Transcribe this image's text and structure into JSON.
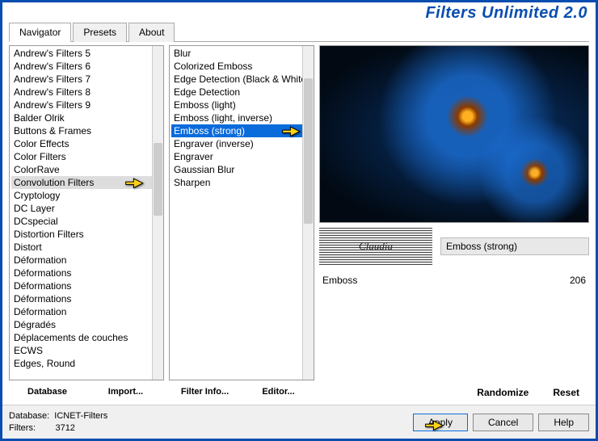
{
  "title": "Filters Unlimited 2.0",
  "tabs": [
    "Navigator",
    "Presets",
    "About"
  ],
  "active_tab": 0,
  "categories": {
    "items": [
      "Andrew's Filters 5",
      "Andrew's Filters 6",
      "Andrew's Filters 7",
      "Andrew's Filters 8",
      "Andrew's Filters 9",
      "Balder Olrik",
      "Buttons & Frames",
      "Color Effects",
      "Color Filters",
      "ColorRave",
      "Convolution Filters",
      "Cryptology",
      "DC Layer",
      "DCspecial",
      "Distortion Filters",
      "Distort",
      "Déformation",
      "Déformations",
      "Déformations",
      "Déformations",
      "Déformation",
      "Dégradés",
      "Déplacements de couches",
      "ECWS",
      "Edges, Round"
    ],
    "highlighted_index": 10,
    "buttons": [
      "Database",
      "Import..."
    ]
  },
  "filters": {
    "items": [
      "Blur",
      "Colorized Emboss",
      "Edge Detection (Black & White)",
      "Edge Detection",
      "Emboss (light)",
      "Emboss (light, inverse)",
      "Emboss (strong)",
      "Engraver (inverse)",
      "Engraver",
      "Gaussian Blur",
      "Sharpen"
    ],
    "selected_index": 6,
    "buttons": [
      "Filter Info...",
      "Editor..."
    ]
  },
  "watermark_text": "Claudia",
  "selected_filter_name": "Emboss (strong)",
  "param": {
    "label": "Emboss",
    "value": "206"
  },
  "right_buttons": [
    "Randomize",
    "Reset"
  ],
  "footer": {
    "db_label": "Database:",
    "db_value": "ICNET-Filters",
    "filters_label": "Filters:",
    "filters_value": "3712",
    "buttons": [
      "Apply",
      "Cancel",
      "Help"
    ]
  }
}
